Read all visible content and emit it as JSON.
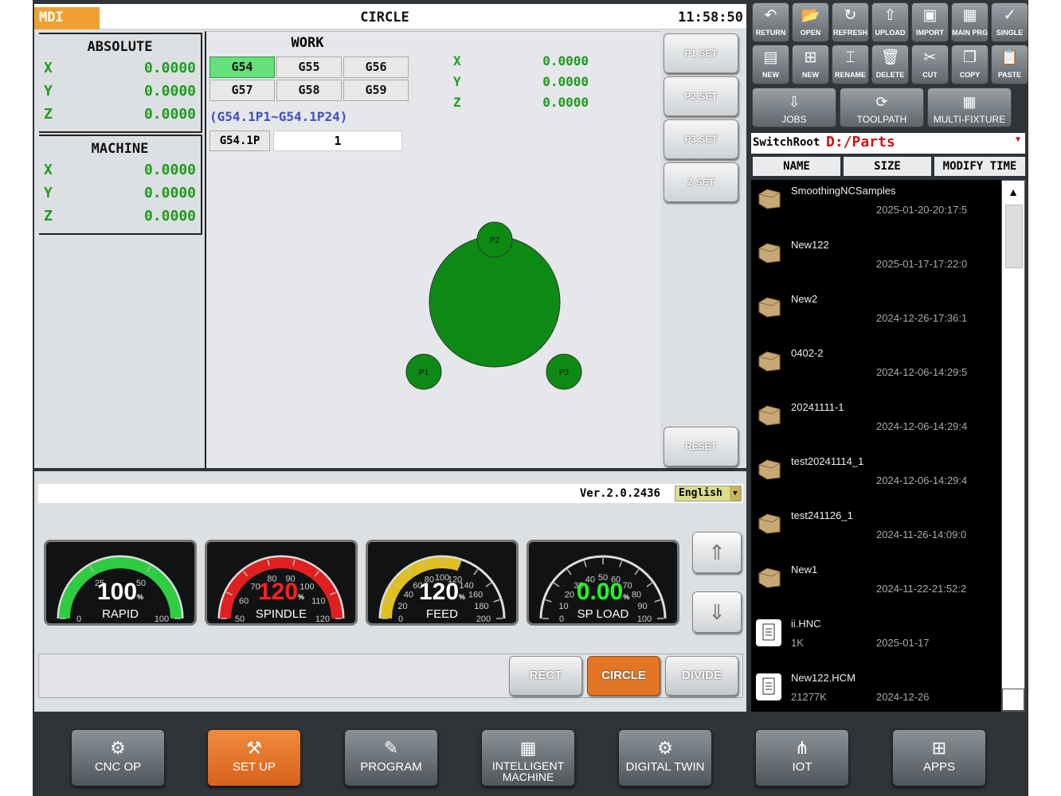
{
  "header": {
    "mode": "MDI",
    "title": "CIRCLE",
    "clock": "11:58:50"
  },
  "absolute": {
    "title": "ABSOLUTE",
    "rows": [
      {
        "axis": "X",
        "value": "0.0000"
      },
      {
        "axis": "Y",
        "value": "0.0000"
      },
      {
        "axis": "Z",
        "value": "0.0000"
      }
    ]
  },
  "machine": {
    "title": "MACHINE",
    "rows": [
      {
        "axis": "X",
        "value": "0.0000"
      },
      {
        "axis": "Y",
        "value": "0.0000"
      },
      {
        "axis": "Z",
        "value": "0.0000"
      }
    ]
  },
  "work": {
    "title": "WORK",
    "buttons": [
      "G54",
      "G55",
      "G56",
      "G57",
      "G58",
      "G59"
    ],
    "active": "G54",
    "range_text": "(G54.1P1~G54.1P24)",
    "ext_label": "G54.1P",
    "ext_value": "1",
    "coords": [
      {
        "axis": "X",
        "value": "0.0000"
      },
      {
        "axis": "Y",
        "value": "0.0000"
      },
      {
        "axis": "Z",
        "value": "0.0000"
      }
    ]
  },
  "side_buttons": [
    "P1 SET",
    "P2 SET",
    "P3 SET",
    "Z SET",
    "RESET"
  ],
  "diagram": {
    "points": [
      "P1",
      "P2",
      "P3"
    ],
    "color": "#0d8a14"
  },
  "status": {
    "version": "Ver.2.0.2436",
    "language": "English"
  },
  "gauges": [
    {
      "label": "RAPID",
      "value": "100",
      "unit": "%",
      "ticks": [
        "0",
        "25",
        "50",
        "100"
      ],
      "arc_color": "#2ecc40",
      "fraction": 1.0
    },
    {
      "label": "SPINDLE",
      "value": "120",
      "unit": "%",
      "ticks": [
        "50",
        "60",
        "70",
        "80",
        "90",
        "100",
        "110",
        "120"
      ],
      "arc_color": "#e02020",
      "fraction": 1.0
    },
    {
      "label": "FEED",
      "value": "120",
      "unit": "%",
      "ticks": [
        "0",
        "20",
        "40",
        "60",
        "80",
        "100",
        "120",
        "140",
        "160",
        "180",
        "200"
      ],
      "arc_color": "#e0c020",
      "fraction": 0.6
    },
    {
      "label": "SP LOAD",
      "value": "0.00",
      "unit": "%",
      "ticks": [
        "0",
        "10",
        "20",
        "30",
        "40",
        "50",
        "60",
        "70",
        "80",
        "90",
        "100"
      ],
      "arc_color": "#2ecc40",
      "fraction": 0.0
    }
  ],
  "arrows": {
    "up": "⇑",
    "down": "⇓"
  },
  "shape_buttons": [
    {
      "label": "RECT",
      "active": false
    },
    {
      "label": "CIRCLE",
      "active": true
    },
    {
      "label": "DIVIDE",
      "active": false
    }
  ],
  "toolbar_row1": [
    {
      "label": "RETURN",
      "icon": "↶"
    },
    {
      "label": "OPEN",
      "icon": "📂"
    },
    {
      "label": "REFRESH",
      "icon": "↻"
    },
    {
      "label": "UPLOAD",
      "icon": "⇧"
    },
    {
      "label": "IMPORT",
      "icon": "▣"
    },
    {
      "label": "MAIN PRG",
      "icon": "▦"
    },
    {
      "label": "SINGLE",
      "icon": "✓"
    }
  ],
  "toolbar_row2": [
    {
      "label": "NEW",
      "icon": "▤"
    },
    {
      "label": "NEW",
      "icon": "⊞"
    },
    {
      "label": "RENAME",
      "icon": "⌶"
    },
    {
      "label": "DELETE",
      "icon": "🗑"
    },
    {
      "label": "CUT",
      "icon": "✂"
    },
    {
      "label": "COPY",
      "icon": "❐"
    },
    {
      "label": "PASTE",
      "icon": "📋"
    }
  ],
  "toolbar_row3": [
    {
      "label": "JOBS",
      "icon": "⇩"
    },
    {
      "label": "TOOLPATH",
      "icon": "⟳"
    },
    {
      "label": "MULTI-FIXTURE",
      "icon": "▦"
    }
  ],
  "switch_root": {
    "label": "SwitchRoot",
    "value": "D:/Parts"
  },
  "file_columns": [
    "NAME",
    "SIZE",
    "MODIFY TIME"
  ],
  "files": [
    {
      "name": "SmoothingNCSamples",
      "size": "",
      "time": "2025-01-20-20:17:5",
      "type": "folder"
    },
    {
      "name": "New122",
      "size": "",
      "time": "2025-01-17-17:22:0",
      "type": "folder"
    },
    {
      "name": "New2",
      "size": "",
      "time": "2024-12-26-17:36:1",
      "type": "folder"
    },
    {
      "name": "0402-2",
      "size": "",
      "time": "2024-12-06-14:29:5",
      "type": "folder"
    },
    {
      "name": "20241111-1",
      "size": "",
      "time": "2024-12-06-14:29:4",
      "type": "folder"
    },
    {
      "name": "test20241114_1",
      "size": "",
      "time": "2024-12-06-14:29:4",
      "type": "folder"
    },
    {
      "name": "test241126_1",
      "size": "",
      "time": "2024-11-26-14:09:0",
      "type": "folder"
    },
    {
      "name": "New1",
      "size": "",
      "time": "2024-11-22-21:52:2",
      "type": "folder"
    },
    {
      "name": "ii.HNC",
      "size": "1K",
      "time": "2025-01-17",
      "type": "file"
    },
    {
      "name": "New122.HCM",
      "size": "21277K",
      "time": "2024-12-26",
      "type": "file"
    }
  ],
  "scroll_up": "▲",
  "nav": [
    {
      "label": "CNC OP",
      "icon": "⚙",
      "active": false
    },
    {
      "label": "SET UP",
      "icon": "⚒",
      "active": true
    },
    {
      "label": "PROGRAM",
      "icon": "✎",
      "active": false
    },
    {
      "label": "INTELLIGENT MACHINE",
      "icon": "▦",
      "active": false
    },
    {
      "label": "DIGITAL TWIN",
      "icon": "⚙",
      "active": false
    },
    {
      "label": "IOT",
      "icon": "⋔",
      "active": false
    },
    {
      "label": "APPS",
      "icon": "⊞",
      "active": false
    }
  ]
}
